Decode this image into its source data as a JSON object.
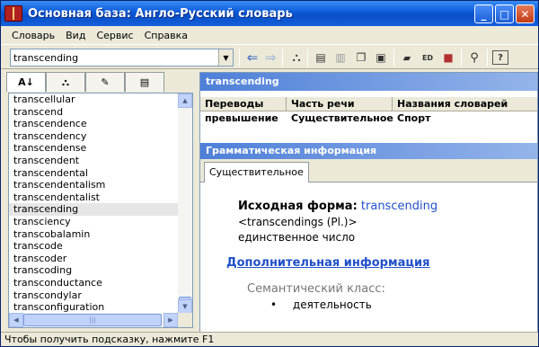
{
  "window": {
    "title": "Основная база: Англо-Русский словарь"
  },
  "menu": [
    "Словарь",
    "Вид",
    "Сервис",
    "Справка"
  ],
  "toolbar": {
    "search_value": "transcending"
  },
  "wordlist": {
    "items": [
      "transcellular",
      "transcend",
      "transcendence",
      "transcendency",
      "transcendense",
      "transcendent",
      "transcendental",
      "transcendentalism",
      "transcendentalist",
      "transcending",
      "transciency",
      "transcobalamin",
      "transcode",
      "transcoder",
      "transcoding",
      "transconductance",
      "transcondylar",
      "transconfiguration"
    ],
    "selected_index": 9,
    "scroll_grip": "|||"
  },
  "article": {
    "headword": "transcending",
    "columns": [
      "Переводы",
      "Часть речи",
      "Названия словарей"
    ],
    "rows": [
      [
        "превышение",
        "Существительное",
        "Спорт"
      ]
    ]
  },
  "grammar": {
    "header": "Грамматическая информация",
    "tab": "Существительное",
    "base_label": "Исходная форма:",
    "base_value": "transcending",
    "plural_line": "<transcendings (Pl.)>",
    "number": "единственное число",
    "more_link": "Дополнительная информация",
    "semantic_label": "Семантический класс:",
    "semantic_value": "деятельность",
    "bullet": "•"
  },
  "status": "Чтобы получить подсказку, нажмите F1",
  "icons": {
    "title_buttons": [
      "minimize-icon",
      "maximize-icon",
      "close-icon"
    ],
    "toolbar": [
      "arrow-left-icon",
      "arrow-right-icon",
      "binoculars-icon",
      "clipboard-icon",
      "clipboard-gray-icon",
      "copy-icon",
      "paste-icon",
      "cap-icon",
      "ed-icon",
      "dictionary-icon",
      "pin-icon",
      "help-icon"
    ]
  }
}
